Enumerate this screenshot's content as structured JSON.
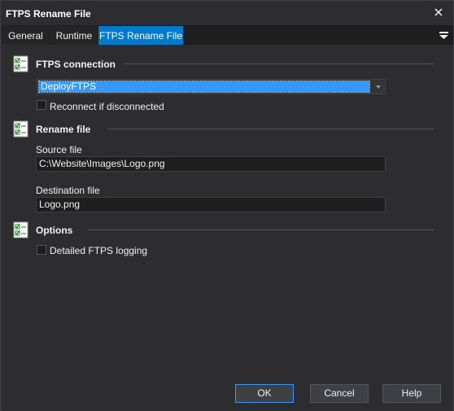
{
  "window": {
    "title": "FTPS Rename File"
  },
  "tabs": [
    {
      "label": "General"
    },
    {
      "label": "Runtime"
    },
    {
      "label": "FTPS Rename File"
    }
  ],
  "sections": {
    "connection": {
      "title": "FTPS connection",
      "selected_connection": "DeployFTPS",
      "reconnect_label": "Reconnect if disconnected",
      "reconnect_checked": false
    },
    "rename": {
      "title": "Rename file",
      "source_label": "Source file",
      "source_value": "C:\\Website\\Images\\Logo.png",
      "destination_label": "Destination file",
      "destination_value": "Logo.png"
    },
    "options": {
      "title": "Options",
      "logging_label": "Detailed FTPS logging",
      "logging_checked": false
    }
  },
  "buttons": {
    "ok": "OK",
    "cancel": "Cancel",
    "help": "Help"
  },
  "colors": {
    "background": "#2d2d30",
    "accent": "#007acc",
    "selection": "#3399ff"
  }
}
